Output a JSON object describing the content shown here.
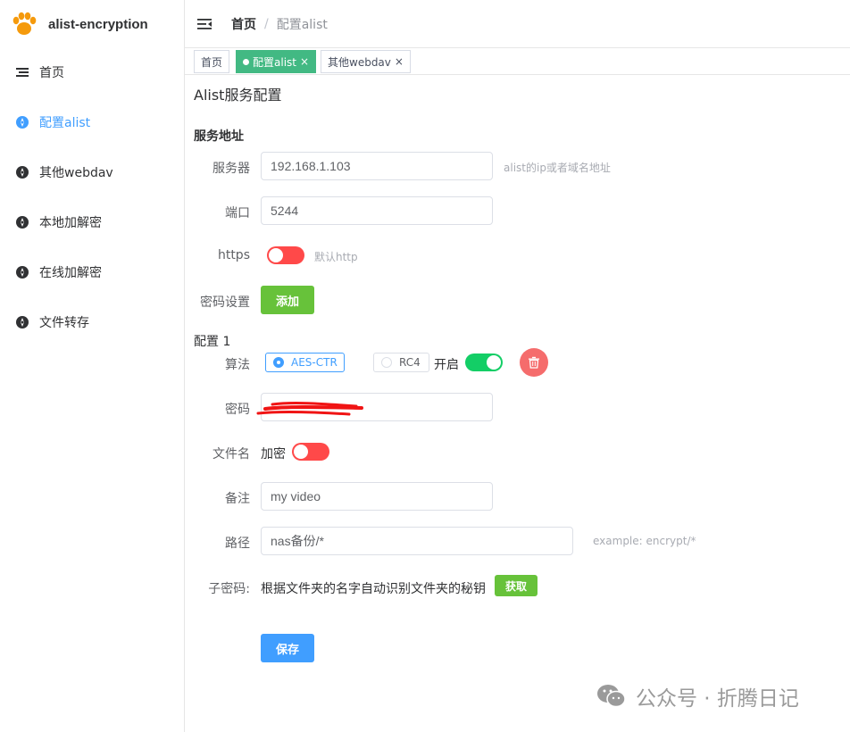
{
  "app": {
    "title": "alist-encryption"
  },
  "sidebar": {
    "items": [
      {
        "label": "首页",
        "icon": "menu-list-icon",
        "active": false
      },
      {
        "label": "配置alist",
        "icon": "compass-icon",
        "active": true
      },
      {
        "label": "其他webdav",
        "icon": "compass-icon",
        "active": false
      },
      {
        "label": "本地加解密",
        "icon": "compass-icon",
        "active": false
      },
      {
        "label": "在线加解密",
        "icon": "compass-icon",
        "active": false
      },
      {
        "label": "文件转存",
        "icon": "compass-icon",
        "active": false
      }
    ]
  },
  "header": {
    "breadcrumb_home": "首页",
    "breadcrumb_sep": "/",
    "breadcrumb_current": "配置alist"
  },
  "tabs": [
    {
      "label": "首页",
      "active": false,
      "closable": false
    },
    {
      "label": "配置alist",
      "active": true,
      "closable": true
    },
    {
      "label": "其他webdav",
      "active": false,
      "closable": true
    }
  ],
  "tab_close_glyph": "×",
  "page": {
    "title": "Alist服务配置",
    "service_section": "服务地址",
    "server_label": "服务器",
    "server_value": "192.168.1.103",
    "server_hint": "alist的ip或者域名地址",
    "port_label": "端口",
    "port_value": "5244",
    "https_label": "https",
    "https_enabled": false,
    "https_hint": "默认http",
    "password_setting_label": "密码设置",
    "add_button": "添加",
    "config_title": "配置 1",
    "algo_label": "算法",
    "algo_options": [
      "AES-CTR",
      "RC4"
    ],
    "algo_selected": "AES-CTR",
    "enable_label": "开启",
    "enabled": true,
    "password_label": "密码",
    "filename_label": "文件名",
    "filename_encrypt_label": "加密",
    "filename_encrypt": false,
    "remark_label": "备注",
    "remark_value": "my video",
    "path_label": "路径",
    "path_value": "nas备份/*",
    "path_hint": "example: encrypt/*",
    "subkey_label": "子密码:",
    "subkey_text": "根据文件夹的名字自动识别文件夹的秘钥",
    "fetch_button": "获取",
    "save_button": "保存"
  },
  "watermark": {
    "text": "公众号 · 折腾日记"
  },
  "colors": {
    "primary": "#409eff",
    "success": "#67c23a",
    "tab_active": "#42b983",
    "switch_off": "#ff4949",
    "switch_on": "#13ce66",
    "danger": "#f56c6c",
    "redaction": "#f01414"
  }
}
